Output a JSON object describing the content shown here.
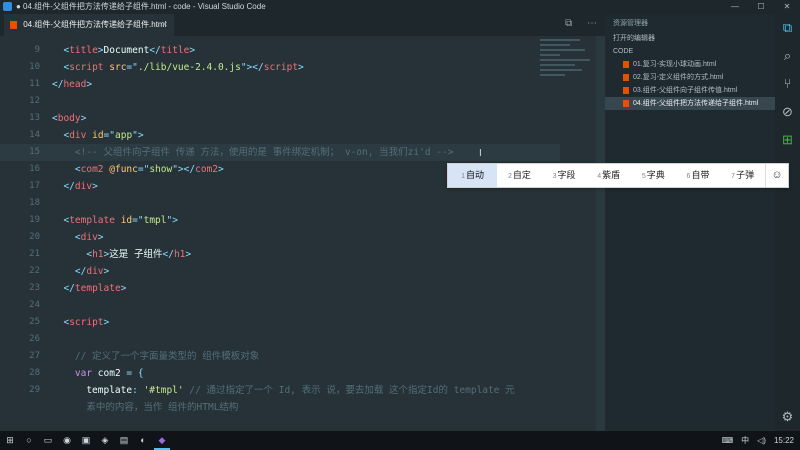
{
  "window": {
    "title": "● 04.组件-父组件把方法传递给子组件.html - code - Visual Studio Code",
    "controls": [
      "—",
      "☐",
      "✕"
    ]
  },
  "tabs": [
    {
      "label": "04.组件-父组件把方法传递给子组件.html",
      "close": "✕"
    }
  ],
  "tab_actions": [
    "⧉",
    "⋯"
  ],
  "editor": {
    "lines": [
      {
        "n": "9",
        "html": "  <span class='p'>&lt;</span><span class='t'>title</span><span class='p'>&gt;</span><span class='w'>Document</span><span class='p'>&lt;/</span><span class='t'>title</span><span class='p'>&gt;</span>"
      },
      {
        "n": "10",
        "html": "  <span class='p'>&lt;</span><span class='t'>script</span> <span class='a'>src</span><span class='p'>=\"</span><span class='s'>./lib/vue-2.4.0.js</span><span class='p'>\"&gt;&lt;/</span><span class='t'>script</span><span class='p'>&gt;</span>"
      },
      {
        "n": "11",
        "html": "<span class='p'>&lt;/</span><span class='t'>head</span><span class='p'>&gt;</span>"
      },
      {
        "n": "12",
        "html": ""
      },
      {
        "n": "13",
        "html": "<span class='p'>&lt;</span><span class='t'>body</span><span class='p'>&gt;</span>"
      },
      {
        "n": "14",
        "html": "  <span class='p'>&lt;</span><span class='t'>div</span> <span class='a'>id</span><span class='p'>=\"</span><span class='s'>app</span><span class='p'>\"&gt;</span>"
      },
      {
        "n": "15",
        "html": "    <span class='c'>&lt;!-- 父组件向子组件 传递 方法，使用的是 事件绑定机制； v-on, 当我们zi'd --&gt;</span>",
        "hl": true
      },
      {
        "n": "16",
        "html": "    <span class='p'>&lt;</span><span class='t'>com2</span> <span class='a'>@func</span><span class='p'>=\"</span><span class='s'>show</span><span class='p'>\"&gt;&lt;/</span><span class='t'>com2</span><span class='p'>&gt;</span>"
      },
      {
        "n": "17",
        "html": "  <span class='p'>&lt;/</span><span class='t'>div</span><span class='p'>&gt;</span>"
      },
      {
        "n": "18",
        "html": ""
      },
      {
        "n": "19",
        "html": "  <span class='p'>&lt;</span><span class='t'>template</span> <span class='a'>id</span><span class='p'>=\"</span><span class='s'>tmpl</span><span class='p'>\"&gt;</span>"
      },
      {
        "n": "20",
        "html": "    <span class='p'>&lt;</span><span class='t'>div</span><span class='p'>&gt;</span>"
      },
      {
        "n": "21",
        "html": "      <span class='p'>&lt;</span><span class='t'>h1</span><span class='p'>&gt;</span><span class='w'>这是 子组件</span><span class='p'>&lt;/</span><span class='t'>h1</span><span class='p'>&gt;</span>"
      },
      {
        "n": "22",
        "html": "    <span class='p'>&lt;/</span><span class='t'>div</span><span class='p'>&gt;</span>"
      },
      {
        "n": "23",
        "html": "  <span class='p'>&lt;/</span><span class='t'>template</span><span class='p'>&gt;</span>"
      },
      {
        "n": "24",
        "html": ""
      },
      {
        "n": "25",
        "html": "  <span class='p'>&lt;</span><span class='t'>script</span><span class='p'>&gt;</span>"
      },
      {
        "n": "26",
        "html": ""
      },
      {
        "n": "27",
        "html": "    <span class='c'>// 定义了一个字面量类型的 组件模板对象</span>"
      },
      {
        "n": "28",
        "html": "    <span class='k'>var</span> <span class='w'>com2</span> <span class='p'>=</span> <span class='p'>{</span>"
      },
      {
        "n": "29",
        "html": "      <span class='w'>template</span><span class='p'>:</span> <span class='s'>'#tmpl'</span> <span class='c'>// 通过指定了一个 Id, 表示 说，要去加载 这个指定Id的 template 元</span>"
      },
      {
        "n": "",
        "html": "      <span class='c'>素中的内容，当作 组件的HTML结构</span>"
      }
    ]
  },
  "sidebar": {
    "header": "资源管理器",
    "open_editors": "打开的编辑器",
    "folder": "CODE",
    "files": [
      "01.复习-实现小球动画.html",
      "02.复习-定义组件的方式.html",
      "03.组件-父组件向子组件传值.html",
      "04.组件-父组件把方法传递给子组件.html"
    ],
    "active_index": 3
  },
  "activity_bar": [
    "⧉",
    "⌕",
    "⑂",
    "⊘",
    "⊞",
    "⚙"
  ],
  "ime": {
    "candidates": [
      {
        "n": "1",
        "text": "自动"
      },
      {
        "n": "2",
        "text": "自定"
      },
      {
        "n": "3",
        "text": "字段"
      },
      {
        "n": "4",
        "text": "紫盾"
      },
      {
        "n": "5",
        "text": "字典"
      },
      {
        "n": "6",
        "text": "自带"
      },
      {
        "n": "7",
        "text": "子弹"
      }
    ],
    "emoji": "☺"
  },
  "taskbar": {
    "icons": [
      "⊞",
      "○",
      "▭",
      "◉",
      "▣",
      "◈",
      "▤",
      "◐",
      "◆"
    ],
    "active_index": 8,
    "tray": {
      "keyboard": "⌨",
      "ime": "中",
      "volume": "◁)",
      "time": "15:22"
    }
  },
  "colors": {
    "editor_bg": "#263238",
    "sidebar_bg": "#1f2a30",
    "accent": "#4fc3f7"
  }
}
